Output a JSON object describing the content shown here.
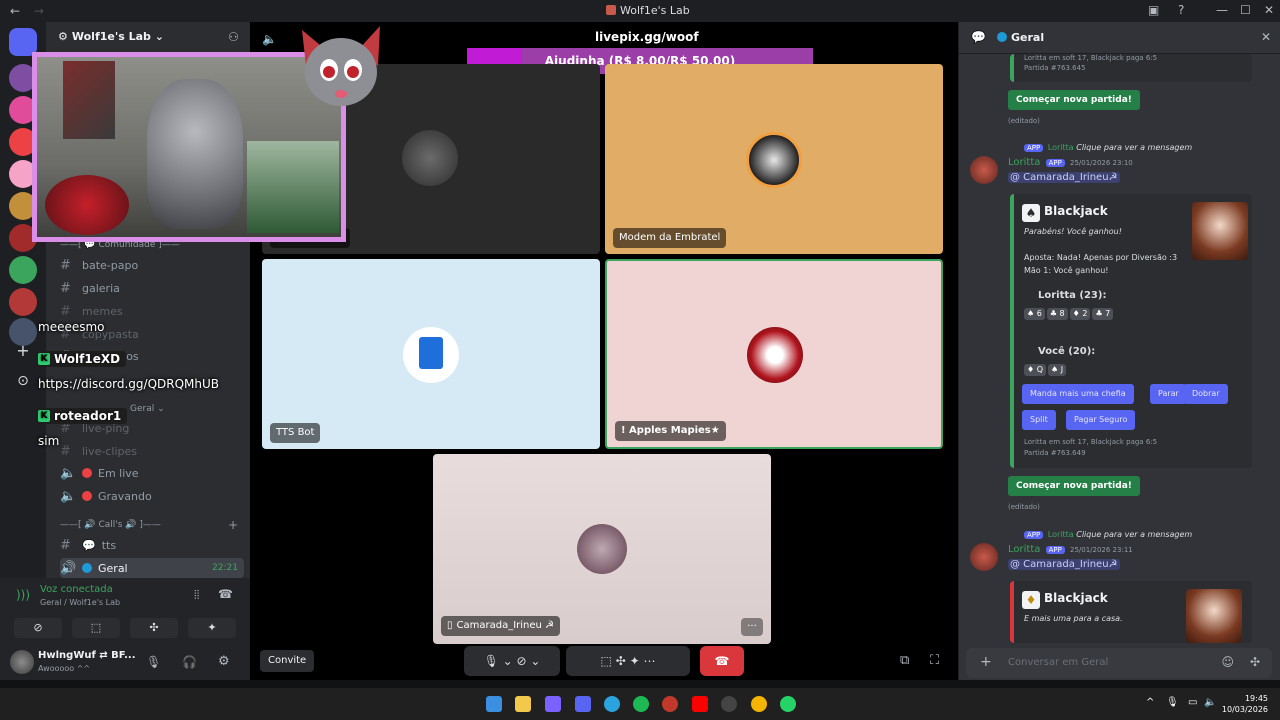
{
  "window": {
    "title": "Wolf1e's Lab",
    "nav_back": "←",
    "nav_forward": "→",
    "minimize": "—",
    "maximize": "☐",
    "close": "✕"
  },
  "sidebar": {
    "server_name": "Wolf1e's Lab ⌄",
    "categories": {
      "comunidade": "——[ 💬 Comunidade ]——",
      "geral_cat": "Geral ⌄",
      "calls": "——[ 🔊 Call's 🔊 ]——"
    },
    "channels": [
      {
        "icon": "#",
        "label": "bate-papo"
      },
      {
        "icon": "#",
        "label": "galeria"
      },
      {
        "icon": "#",
        "label": "memes"
      },
      {
        "icon": "#",
        "label": "copypasta"
      },
      {
        "icon": "#",
        "label": "comandos"
      },
      {
        "icon": "#",
        "label": "live-ping"
      },
      {
        "icon": "#",
        "label": "live-clipes"
      }
    ],
    "voice_channels": [
      {
        "label": "Em live"
      },
      {
        "label": "Gravando"
      },
      {
        "label": "tts"
      },
      {
        "label": "Geral",
        "time": "22:21"
      }
    ]
  },
  "voice_panel": {
    "status": "Voz conectada",
    "location": "Geral / Wolf1e's Lab"
  },
  "user_panel": {
    "name": "HwlngWuf ⇄ BF...",
    "status": "Awooooo ^^"
  },
  "overlay_chat": {
    "lines": [
      {
        "type": "text",
        "text": "meeeesmo"
      },
      {
        "type": "user",
        "text": "Wolf1eXD"
      },
      {
        "type": "text",
        "text": "https://discord.gg/QDRQMhUB"
      },
      {
        "type": "user",
        "text": "roteador1"
      },
      {
        "type": "text",
        "text": "sim"
      }
    ],
    "badge": "K"
  },
  "stage": {
    "livepix_url": "livepix.gg/woof",
    "goal_label": "Ajudinha (R$ 8,00/R$ 50,00)",
    "goal_progress": 0.16,
    "tiles": [
      {
        "label": "BFF 4300 a.c."
      },
      {
        "label": "Modem da Embratel"
      },
      {
        "label": "TTS Bot"
      },
      {
        "label": "! Apples Mapies★"
      },
      {
        "label": "Camarada_Irineu ☭"
      }
    ],
    "invite_label": "Convite",
    "more_label": "···"
  },
  "chat": {
    "header": "Geral",
    "messages": [
      {
        "reply_user": "Loritta",
        "reply_text": "Clique para ver a mensagem",
        "author": "Loritta",
        "app_tag": "APP",
        "timestamp": "25/01/2026 23:10",
        "mention": "@ Camarada_Irineu☭",
        "embed_title": "Blackjack",
        "result": "Parabéns! Você ganhou!",
        "bet": "Aposta: Nada! Apenas por Diversão :3",
        "hand1": "Mão 1: Você ganhou!",
        "loritta_score": "Loritta (23):",
        "loritta_cards": [
          "♠ 6",
          "♣ 8",
          "♦ 2",
          "♣ 7"
        ],
        "you_score": "Você (20):",
        "you_cards": [
          "♦ Q",
          "♠ J"
        ],
        "buttons": [
          "Manda mais uma chefia",
          "Parar",
          "Dobrar",
          "Split",
          "Pagar Seguro"
        ],
        "footer": "Loritta em soft 17, Blackjack paga 6:5",
        "match": "Partida #763.649"
      },
      {
        "reply_user": "Loritta",
        "reply_text": "Clique para ver a mensagem",
        "author": "Loritta",
        "app_tag": "APP",
        "timestamp": "25/01/2026 23:11",
        "mention": "@ Camarada_Irineu☭",
        "embed_title": "Blackjack",
        "result": "E mais uma para a casa."
      }
    ],
    "prev_footer": "Loritta em soft 17, Blackjack paga 6:5",
    "prev_match": "Partida #763.645",
    "new_game_button": "Começar nova partida!",
    "edited": "(editado)",
    "input_placeholder": "Conversar em  Geral"
  },
  "taskbar": {
    "time": "19:45",
    "date": "10/03/2026"
  },
  "colors": {
    "accent_green": "#3ba55d",
    "discord_blurple": "#5865f2",
    "hangup_red": "#da373c",
    "goal_bar": "#c21bd6"
  }
}
